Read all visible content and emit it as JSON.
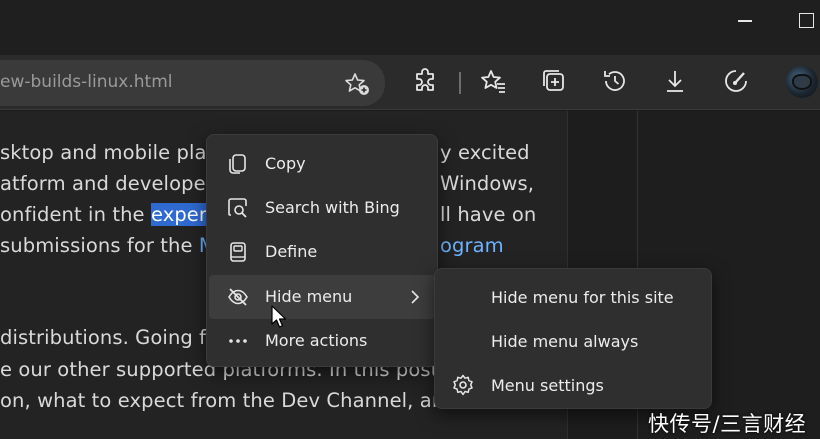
{
  "toolbar": {
    "address_text": "ew-builds-linux.html",
    "icons": [
      "add-favorite-icon",
      "extensions-icon",
      "favorites-icon",
      "collections-icon",
      "history-icon",
      "downloads-icon",
      "performance-icon",
      "profile-avatar"
    ]
  },
  "page": {
    "lines": [
      {
        "pre": "sktop and mobile plat",
        "hl": "",
        "post": "",
        "right": "y excited"
      },
      {
        "pre": "atform and develope",
        "hl": "",
        "post": "",
        "right": "Windows,"
      },
      {
        "pre": "onfident in the ",
        "hl": "experi",
        "post": "",
        "right": "ll have on"
      },
      {
        "pre": "submissions for the ",
        "hl": "",
        "post": "M",
        "right": "ogram"
      },
      {
        "pre": "distributions. Going f",
        "hl": "",
        "post": "",
        "right": ""
      },
      {
        "pre": "e our other supported platforms. In this post",
        "hl": "",
        "post": "",
        "right": ""
      },
      {
        "pre": "on, what to expect from the Dev Channel, and",
        "hl": "",
        "post": "",
        "right": ""
      }
    ]
  },
  "context_menu": {
    "items": [
      {
        "label": "Copy",
        "icon": "copy-icon"
      },
      {
        "label": "Search with Bing",
        "icon": "search-bing-icon"
      },
      {
        "label": "Define",
        "icon": "dictionary-icon"
      },
      {
        "label": "Hide menu",
        "icon": "hide-eye-icon",
        "has_submenu": true,
        "hovered": true
      },
      {
        "label": "More actions",
        "icon": "more-dots-icon"
      }
    ]
  },
  "submenu": {
    "items": [
      {
        "label": "Hide menu for this site"
      },
      {
        "label": "Hide menu always"
      },
      {
        "label": "Menu settings",
        "icon": "gear-icon"
      }
    ]
  },
  "watermark": "快传号/三言财经",
  "colors": {
    "selection": "#2f6ad1",
    "link": "#6eb1ff",
    "menu_bg": "#2f2f2f",
    "menu_hover": "#3d3d3d"
  }
}
